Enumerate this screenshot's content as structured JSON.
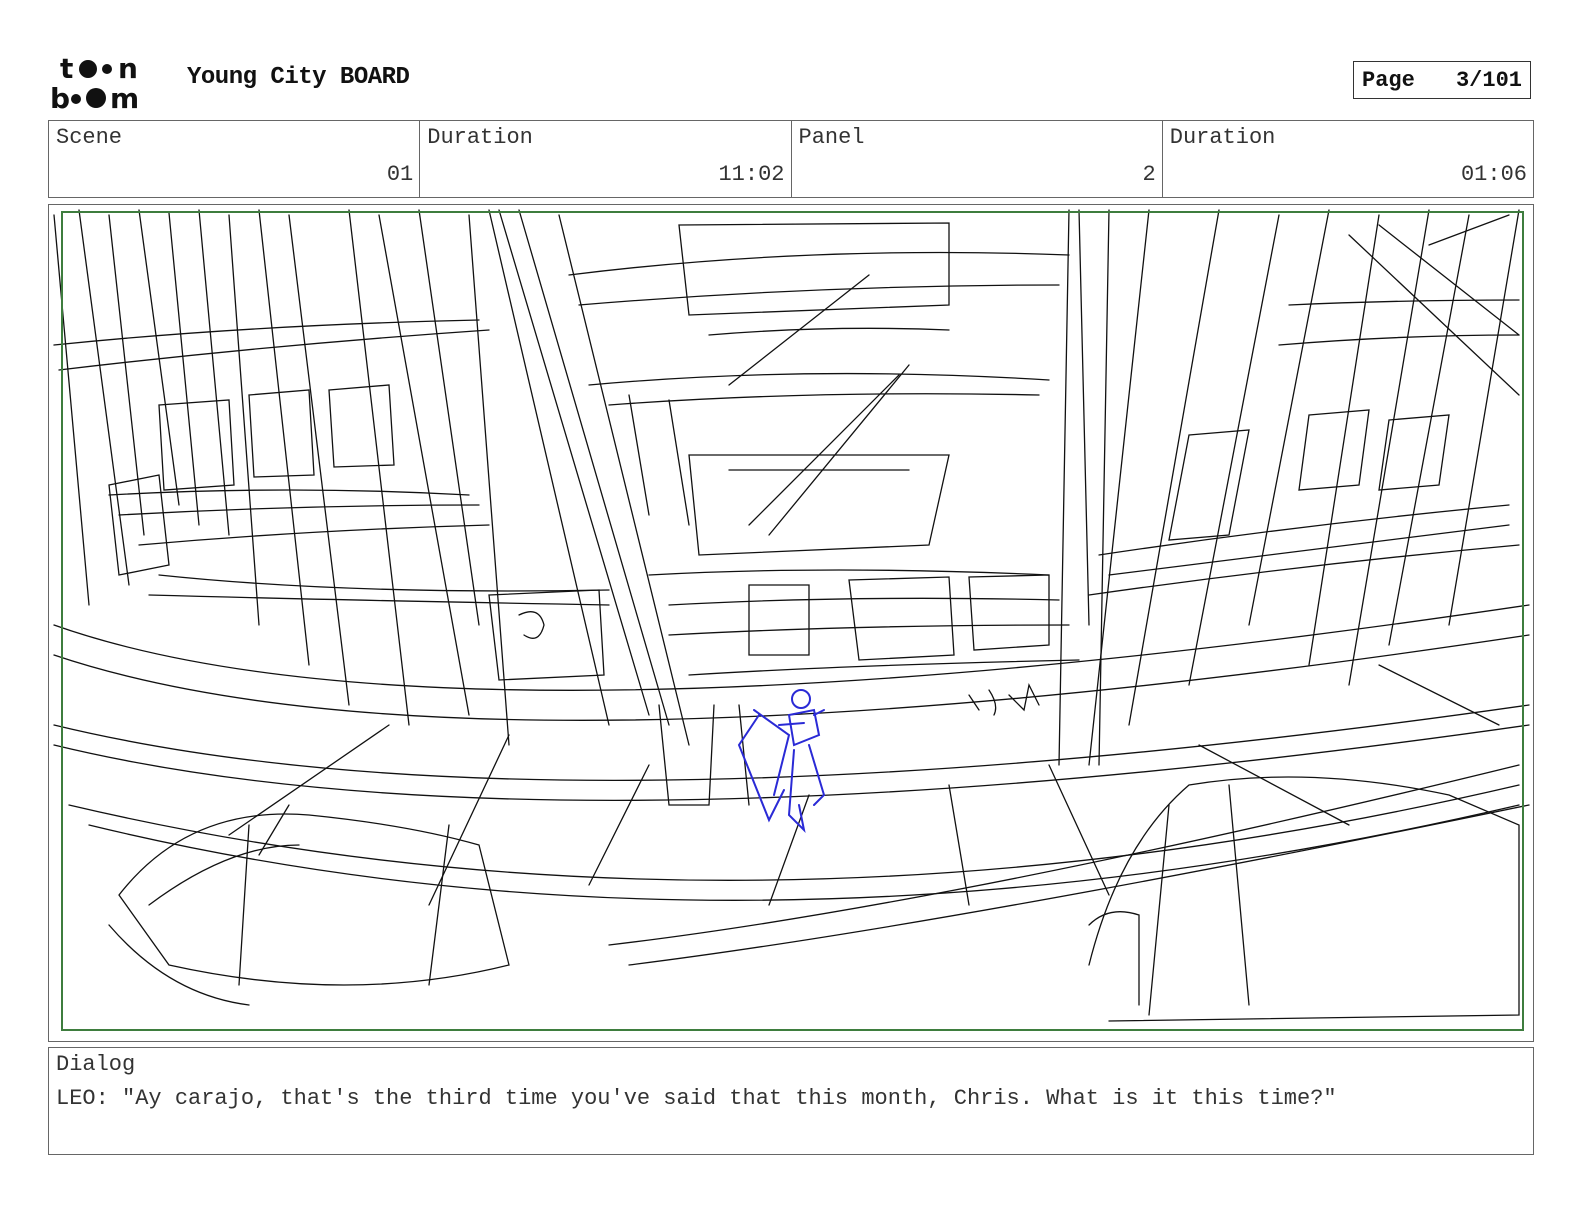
{
  "header": {
    "logo_text": "toon boom",
    "title": "Young City BOARD",
    "page_label": "Page",
    "page_value": "3/101"
  },
  "info": {
    "scene_label": "Scene",
    "scene_value": "01",
    "duration_label": "Duration",
    "duration_value": "11:02",
    "panel_label": "Panel",
    "panel_value": "2",
    "panel_duration_label": "Duration",
    "panel_duration_value": "01:06"
  },
  "panel": {
    "frame_color": "#3e7d3e",
    "line_color": "#111111",
    "character_color": "#2a2ad6"
  },
  "dialog": {
    "label": "Dialog",
    "text": "LEO: \"Ay carajo, that's the third time you've said that this month, Chris. What is it this time?\""
  }
}
